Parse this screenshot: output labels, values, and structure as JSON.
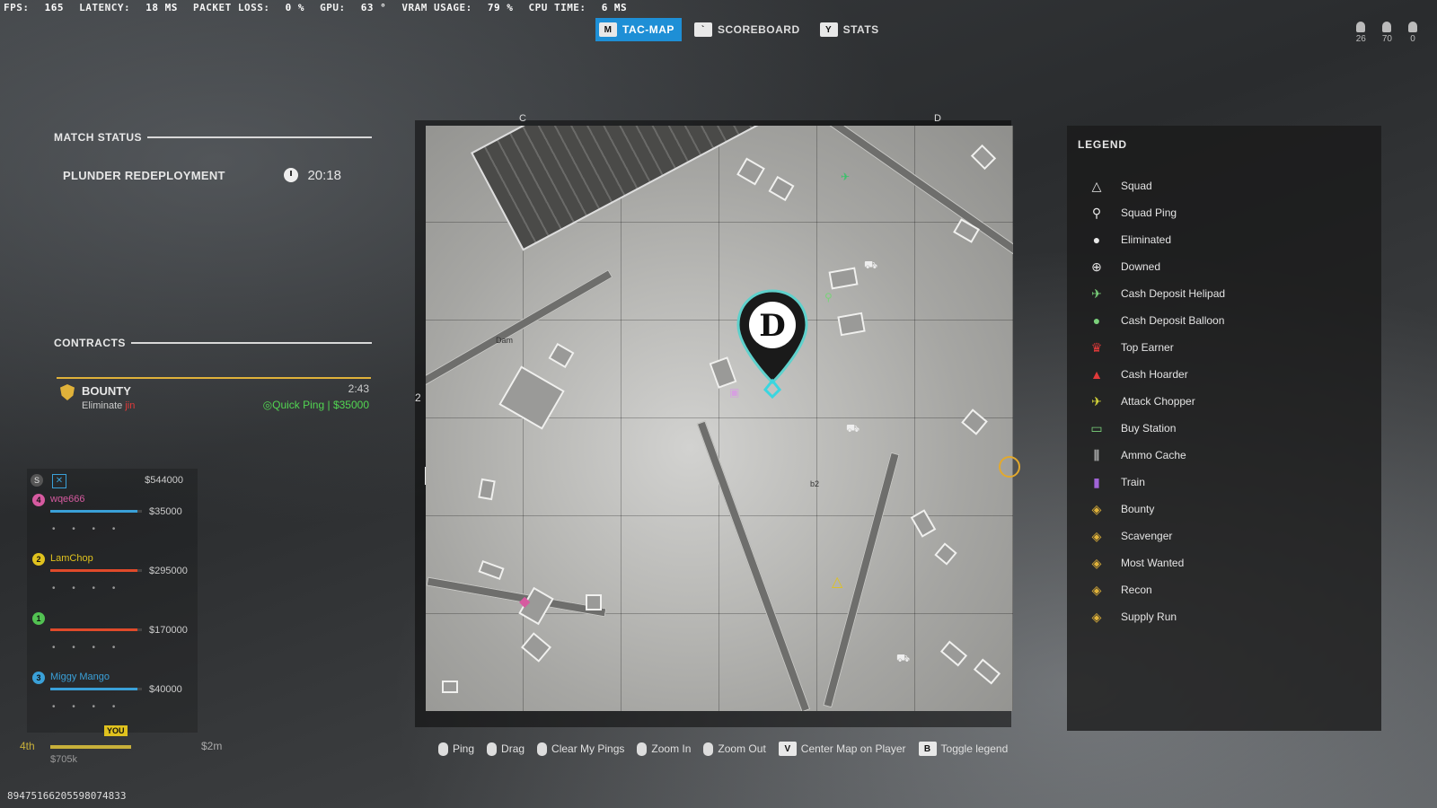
{
  "perf": {
    "fps_label": "FPS:",
    "fps": "165",
    "latency_label": "LATENCY:",
    "latency": "18 MS",
    "loss_label": "PACKET LOSS:",
    "loss": "0 %",
    "gpu_label": "GPU:",
    "gpu": "63 °",
    "vram_label": "VRAM USAGE:",
    "vram": "79 %",
    "cpu_label": "CPU TIME:",
    "cpu": "6 MS"
  },
  "tabs": [
    {
      "key": "M",
      "label": "TAC-MAP"
    },
    {
      "key": "`",
      "label": "SCOREBOARD"
    },
    {
      "key": "Y",
      "label": "STATS"
    }
  ],
  "counters": [
    "26",
    "70",
    "0"
  ],
  "match": {
    "header": "MATCH STATUS",
    "mode": "PLUNDER REDEPLOYMENT",
    "timer": "20:18"
  },
  "contracts": {
    "header": "CONTRACTS",
    "bounty_title": "BOUNTY",
    "bounty_desc": "Eliminate",
    "bounty_target": "jin",
    "time": "2:43",
    "quick_ping": "Quick Ping",
    "sep": "|",
    "reward": "$35000"
  },
  "squad": {
    "team_letter": "S",
    "team_cash": "$544000",
    "members": [
      {
        "num": "4",
        "name": "wqe666",
        "cash": "$35000",
        "color": "#d65aa0",
        "bar": "#3aa0d8",
        "bar_level": 0.95
      },
      {
        "num": "2",
        "name": "LamChop",
        "cash": "$295000",
        "color": "#e0c21e",
        "bar": "#e04a2a",
        "bar_level": 0.95
      },
      {
        "num": "1",
        "name": "",
        "cash": "$170000",
        "color": "#52c252",
        "bar": "#e04a2a",
        "bar_level": 0.95
      },
      {
        "num": "3",
        "name": "Miggy Mango",
        "cash": "$40000",
        "color": "#3aa0d8",
        "bar": "#3aa0d8",
        "bar_level": 0.95
      }
    ]
  },
  "rank": {
    "position": "4th",
    "you": "YOU",
    "potential": "$2m",
    "total": "$705k"
  },
  "player_id": "89475166205598074833",
  "map": {
    "col_c": "C",
    "col_d": "D",
    "row_2": "2",
    "dam_label": "Dam",
    "zone_label": "b2"
  },
  "legend": {
    "title": "LEGEND",
    "items": [
      {
        "icon": "squad-icon",
        "glyph": "△",
        "color": "#e8e8e8",
        "label": "Squad"
      },
      {
        "icon": "squad-ping-icon",
        "glyph": "⚲",
        "color": "#e8e8e8",
        "label": "Squad Ping"
      },
      {
        "icon": "eliminated-icon",
        "glyph": "●",
        "color": "#e8e8e8",
        "label": "Eliminated"
      },
      {
        "icon": "downed-icon",
        "glyph": "⊕",
        "color": "#e8e8e8",
        "label": "Downed"
      },
      {
        "icon": "cash-deposit-helipad-icon",
        "glyph": "✈",
        "color": "#7bd17b",
        "label": "Cash Deposit Helipad"
      },
      {
        "icon": "cash-deposit-balloon-icon",
        "glyph": "●",
        "color": "#7bd17b",
        "label": "Cash Deposit Balloon"
      },
      {
        "icon": "top-earner-icon",
        "glyph": "♛",
        "color": "#e03a3a",
        "label": "Top Earner"
      },
      {
        "icon": "cash-hoarder-icon",
        "glyph": "▲",
        "color": "#e03a3a",
        "label": "Cash Hoarder"
      },
      {
        "icon": "attack-chopper-icon",
        "glyph": "✈",
        "color": "#d6d63a",
        "label": "Attack Chopper"
      },
      {
        "icon": "buy-station-icon",
        "glyph": "▭",
        "color": "#7bd17b",
        "label": "Buy Station"
      },
      {
        "icon": "ammo-cache-icon",
        "glyph": "⫼",
        "color": "#e8e8e8",
        "label": "Ammo Cache"
      },
      {
        "icon": "train-icon",
        "glyph": "▮",
        "color": "#a064d6",
        "label": "Train"
      },
      {
        "icon": "bounty-icon",
        "glyph": "◈",
        "color": "#e0b23a",
        "label": "Bounty"
      },
      {
        "icon": "scavenger-icon",
        "glyph": "◈",
        "color": "#e0b23a",
        "label": "Scavenger"
      },
      {
        "icon": "most-wanted-icon",
        "glyph": "◈",
        "color": "#e0b23a",
        "label": "Most Wanted"
      },
      {
        "icon": "recon-icon",
        "glyph": "◈",
        "color": "#e0b23a",
        "label": "Recon"
      },
      {
        "icon": "supply-run-icon",
        "glyph": "◈",
        "color": "#e0b23a",
        "label": "Supply Run"
      }
    ]
  },
  "controls": [
    {
      "icon": "mouse-left-icon",
      "key": "",
      "label": "Ping"
    },
    {
      "icon": "mouse-right-icon",
      "key": "",
      "label": "Drag"
    },
    {
      "icon": "mouse-icon",
      "key": "",
      "label": "Clear My Pings"
    },
    {
      "icon": "scroll-up-icon",
      "key": "",
      "label": "Zoom In"
    },
    {
      "icon": "scroll-down-icon",
      "key": "",
      "label": "Zoom Out"
    },
    {
      "icon": "",
      "key": "V",
      "label": "Center Map on Player"
    },
    {
      "icon": "",
      "key": "B",
      "label": "Toggle legend"
    }
  ]
}
